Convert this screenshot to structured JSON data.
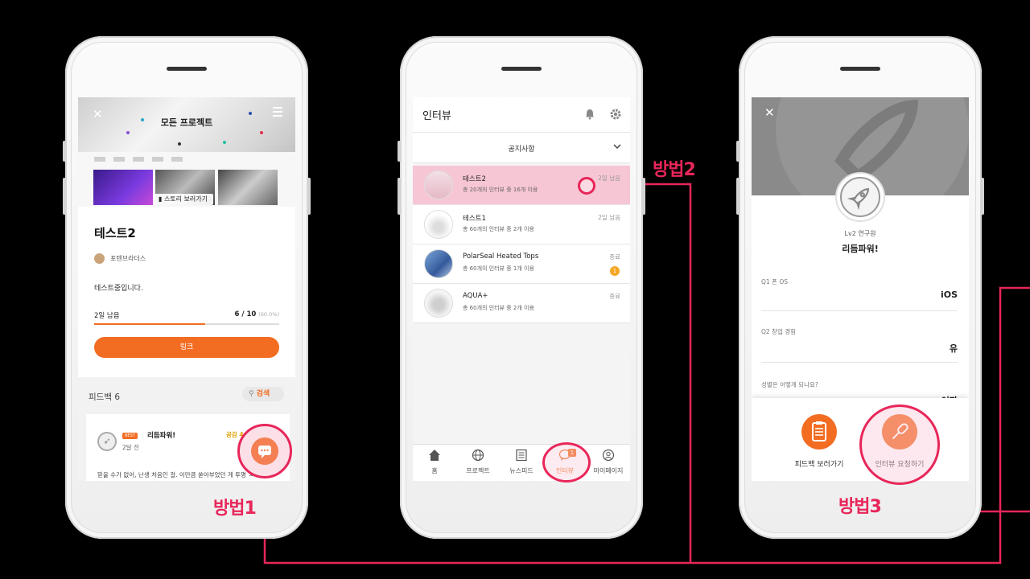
{
  "colors": {
    "accent": "#f26c22",
    "annotation": "#e8265a",
    "highlight_row": "#f7c6d4"
  },
  "annotations": {
    "method1": "방법1",
    "method2": "방법2",
    "method3": "방법3"
  },
  "phone1": {
    "header_title": "모든 프로젝트",
    "story_button": "스토리 보러가기",
    "project_name": "테스트2",
    "team_name": "포텐브라더스",
    "description": "테스트중입니다.",
    "remaining": "2일 남음",
    "progress_text": "6 / 10",
    "progress_percent": "(60.0%)",
    "progress_value": 0.6,
    "link_button": "링크",
    "feedback_label": "피드백 6",
    "search_button": "검색",
    "post": {
      "badge": "BEST",
      "user": "리듬파워!",
      "time": "2달 전",
      "likes": "공감 4",
      "body": "믿을 수가 없어, 난생 처음인 걸. 이만큼 쏟아부었던 게 투명 ㅅ"
    }
  },
  "phone2": {
    "title": "인터뷰",
    "notice": "공지사항",
    "rows": [
      {
        "title": "테스트2",
        "subtitle": "총 20개의 인터뷰 중 16개 이용",
        "right": "2일 남음",
        "badge": ""
      },
      {
        "title": "테스트1",
        "subtitle": "총 60개의 인터뷰 중 2개 이용",
        "right": "2일 남음",
        "badge": ""
      },
      {
        "title": "PolarSeal Heated Tops",
        "subtitle": "총 60개의 인터뷰 중 1개 이용",
        "right": "종료",
        "badge": "1"
      },
      {
        "title": "AQUA+",
        "subtitle": "총 60개의 인터뷰 중 2개 이용",
        "right": "종료",
        "badge": ""
      }
    ],
    "nav": [
      {
        "label": "홈",
        "icon": "home-icon"
      },
      {
        "label": "프로젝트",
        "icon": "globe-icon"
      },
      {
        "label": "뉴스피드",
        "icon": "news-icon"
      },
      {
        "label": "인터뷰",
        "icon": "chat-icon",
        "badge": "1"
      },
      {
        "label": "마이페이지",
        "icon": "user-icon"
      }
    ]
  },
  "phone3": {
    "level": "Lv2 연구원",
    "user_name": "리듬파워!",
    "qa": [
      {
        "q": "Q1 폰 OS",
        "a": "iOS"
      },
      {
        "q": "Q2 창업 경험",
        "a": "유"
      },
      {
        "q": "성별은 어떻게 되나요?",
        "a": "여자"
      }
    ],
    "actions": {
      "feedback": "피드백 보러가기",
      "request": "인터뷰 요청하기"
    }
  }
}
